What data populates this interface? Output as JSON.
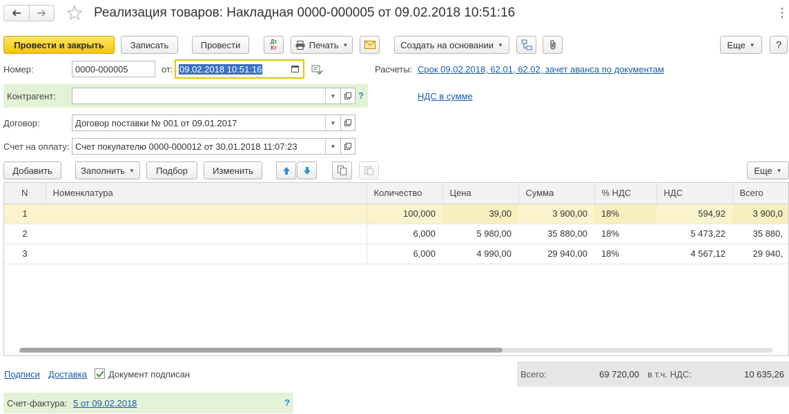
{
  "window": {
    "title": "Реализация товаров: Накладная 0000-000005 от 09.02.2018 10:51:16",
    "more_label": "⋮"
  },
  "toolbar": {
    "post_close": "Провести и закрыть",
    "save": "Записать",
    "post": "Провести",
    "dtkt_top": "Дт",
    "dtkt_bottom": "Кт",
    "print": "Печать",
    "create_based": "Создать на основании",
    "more": "Еще"
  },
  "header": {
    "number_label": "Номер:",
    "number_value": "0000-000005",
    "from_label": "от:",
    "date_value": "09.02.2018 10:51:16",
    "settlements_label": "Расчеты:",
    "settlements_link": "Срок 09.02.2018, 62.01, 62.02, зачет аванса по документам",
    "counterparty_label": "Контрагент:",
    "counterparty_value": "",
    "help": "?",
    "vat_link": "НДС в сумме",
    "contract_label": "Договор:",
    "contract_value": "Договор поставки № 001 от 09.01.2017",
    "invoice_label": "Счет на оплату:",
    "invoice_value": "Счет покупателю 0000-000012 от 30.01.2018 11:07:23"
  },
  "table_toolbar": {
    "add": "Добавить",
    "fill": "Заполнить",
    "select": "Подбор",
    "change": "Изменить",
    "more": "Еще"
  },
  "table": {
    "columns": [
      "N",
      "Номенклатура",
      "Количество",
      "Цена",
      "Сумма",
      "% НДС",
      "НДС",
      "Всего"
    ],
    "rows": [
      {
        "n": "1",
        "item": "",
        "qty": "100,000",
        "price": "39,00",
        "sum": "3 900,00",
        "vat_rate": "18%",
        "vat": "594,92",
        "total": "3 900,0"
      },
      {
        "n": "2",
        "item": "",
        "qty": "6,000",
        "price": "5 980,00",
        "sum": "35 880,00",
        "vat_rate": "18%",
        "vat": "5 473,22",
        "total": "35 880,"
      },
      {
        "n": "3",
        "item": "",
        "qty": "6,000",
        "price": "4 990,00",
        "sum": "29 940,00",
        "vat_rate": "18%",
        "vat": "4 567,12",
        "total": "29 940,"
      }
    ]
  },
  "footer": {
    "signatures": "Подписи",
    "delivery": "Доставка",
    "signed": "Документ подписан",
    "total_label": "Всего:",
    "total_value": "69 720,00",
    "vat_label": "в т.ч. НДС:",
    "vat_value": "10 635,26",
    "invoice_label": "Счет-фактура:",
    "invoice_link": "5 от 09.02.2018",
    "help": "?"
  }
}
